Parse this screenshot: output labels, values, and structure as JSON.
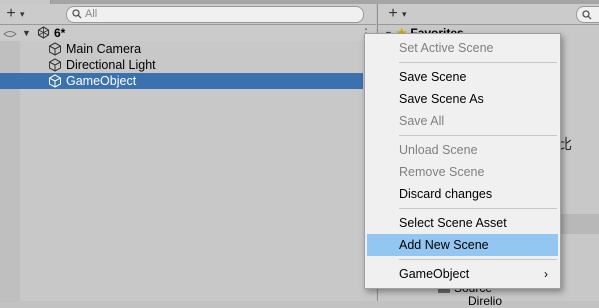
{
  "hierarchy": {
    "search_placeholder": "All",
    "scene_name": "6*",
    "items": [
      {
        "label": "Main Camera"
      },
      {
        "label": "Directional Light"
      },
      {
        "label": "GameObject"
      }
    ]
  },
  "project": {
    "favorites_label": "Favorites",
    "source_label": "Source",
    "source_child_partial": "Direlio",
    "cjk_char": "比"
  },
  "context_menu": {
    "items": [
      {
        "label": "Set Active Scene",
        "enabled": false
      },
      {
        "label": "Save Scene",
        "enabled": true
      },
      {
        "label": "Save Scene As",
        "enabled": true
      },
      {
        "label": "Save All",
        "enabled": false
      },
      {
        "label": "Unload Scene",
        "enabled": false
      },
      {
        "label": "Remove Scene",
        "enabled": false
      },
      {
        "label": "Discard changes",
        "enabled": true
      },
      {
        "label": "Select Scene Asset",
        "enabled": true
      },
      {
        "label": "Add New Scene",
        "enabled": true,
        "highlighted": true
      },
      {
        "label": "GameObject",
        "enabled": true,
        "submenu": true
      }
    ],
    "submenu_arrow": "›"
  },
  "colors": {
    "selection": "#3a72b0",
    "menu_highlight": "#94c6f2",
    "favorite_star": "#d9a300"
  },
  "icons": {
    "toolbar_add": "+",
    "dropdown": "▾",
    "search": "⌕",
    "scene": "unity-scene-icon",
    "gameobject": "cube-icon",
    "kebab": "⋮",
    "star": "★",
    "expand": "▼"
  }
}
